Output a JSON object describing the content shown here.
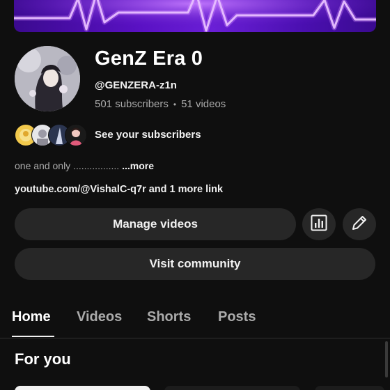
{
  "channel": {
    "name": "GenZ Era 0",
    "handle": "@GENZERA-z1n",
    "subscribers": "501 subscribers",
    "separator": "•",
    "videos": "51 videos",
    "see_subscribers": "See your subscribers",
    "description": "one and only .................",
    "description_more": "...more",
    "links": "youtube.com/@VishalC-q7r and 1 more link"
  },
  "buttons": {
    "manage_videos": "Manage videos",
    "visit_community": "Visit community",
    "analytics_icon": "analytics-chart-icon",
    "edit_icon": "pencil-edit-icon"
  },
  "tabs": [
    {
      "label": "Home",
      "active": true
    },
    {
      "label": "Videos",
      "active": false
    },
    {
      "label": "Shorts",
      "active": false
    },
    {
      "label": "Posts",
      "active": false
    }
  ],
  "sections": {
    "for_you": "For you"
  },
  "colors": {
    "background": "#0f0f0f",
    "button_bg": "#272727",
    "secondary_text": "#aaaaaa",
    "banner_purple": "#5a11c4"
  }
}
